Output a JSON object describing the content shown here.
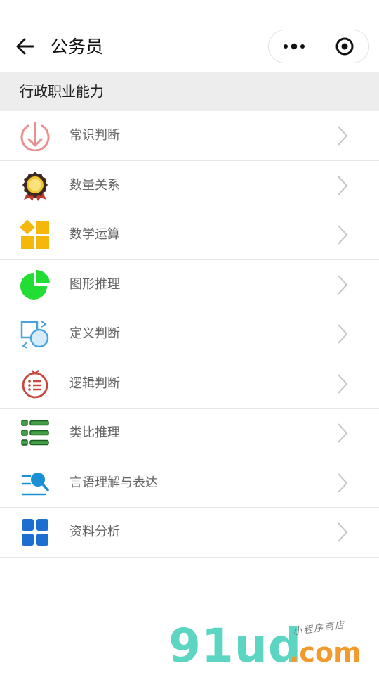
{
  "navbar": {
    "back_icon": "arrow-left-icon",
    "title": "公务员",
    "capsule": {
      "more_icon": "more-dots-icon",
      "close_icon": "target-circle-icon"
    }
  },
  "section": {
    "title": "行政职业能力"
  },
  "items": [
    {
      "label": "常识判断",
      "icon": "download-arrow-circle-icon",
      "color": "#e98f8f"
    },
    {
      "label": "数量关系",
      "icon": "medal-badge-icon",
      "color": "#c0392b"
    },
    {
      "label": "数学运算",
      "icon": "four-squares-icon",
      "color": "#f5b80a"
    },
    {
      "label": "图形推理",
      "icon": "pie-chart-icon",
      "color": "#22dd33"
    },
    {
      "label": "定义判断",
      "icon": "square-circle-cycle-icon",
      "color": "#4aa3df"
    },
    {
      "label": "逻辑判断",
      "icon": "timer-list-icon",
      "color": "#c9463d"
    },
    {
      "label": "类比推理",
      "icon": "bullet-list-icon",
      "color": "#2e7d32"
    },
    {
      "label": "言语理解与表达",
      "icon": "search-lines-icon",
      "color": "#1b8fd6"
    },
    {
      "label": "资料分析",
      "icon": "grid-squares-icon",
      "color": "#1c6fd0"
    }
  ],
  "arrow_icon": "chevron-right-icon",
  "watermark": {
    "main": "91ud",
    "suffix": ".com",
    "tagline": "小程序商店"
  }
}
